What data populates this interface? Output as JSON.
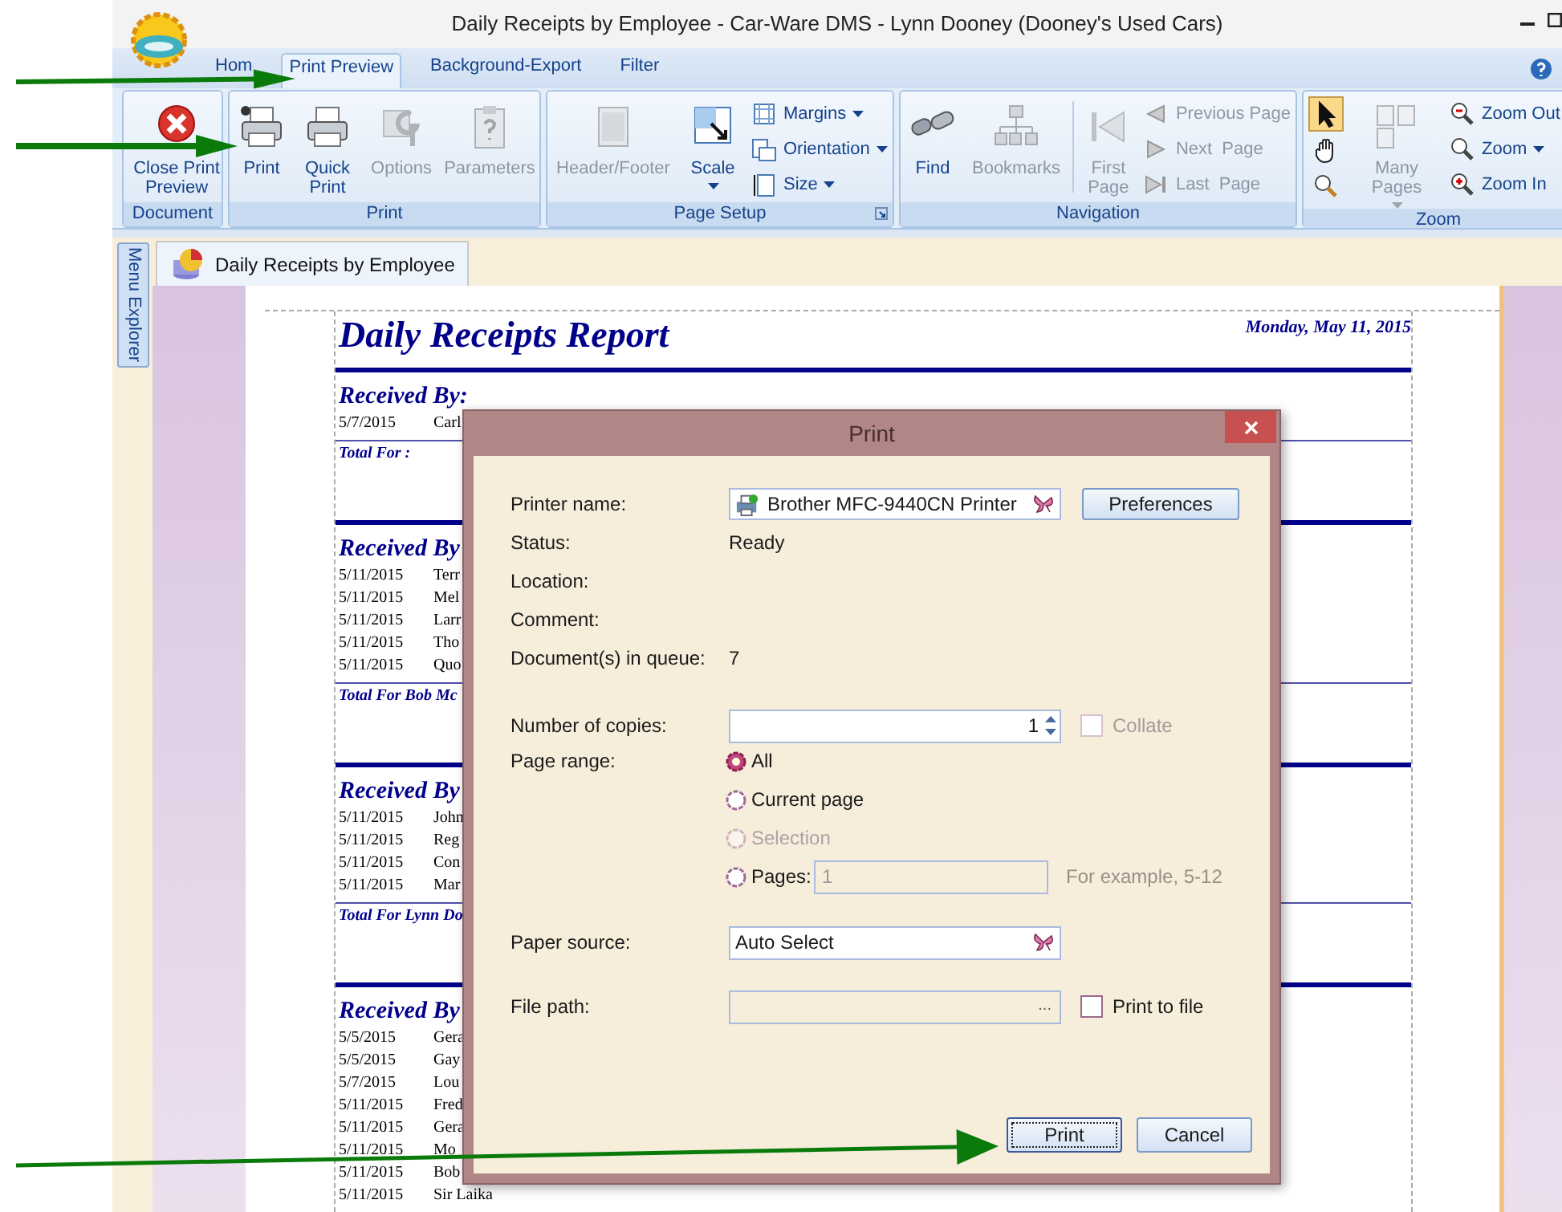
{
  "window": {
    "title": "Daily Receipts by Employee - Car-Ware DMS - Lynn Dooney (Dooney's Used Cars)"
  },
  "ribbon_tabs": [
    {
      "label": "Hom",
      "selected": false
    },
    {
      "label": "Print Preview",
      "selected": true
    },
    {
      "label": "Background-Export",
      "selected": false
    },
    {
      "label": "Filter",
      "selected": false
    }
  ],
  "ribbon_groups": [
    {
      "title": "Document",
      "launcher": false,
      "items": [
        {
          "kind": "large",
          "label": "Close Print Preview",
          "disabled": false,
          "dropdown": false
        }
      ]
    },
    {
      "title": "Print",
      "launcher": false,
      "items": [
        {
          "kind": "large",
          "label": "Print",
          "disabled": false,
          "dropdown": false
        },
        {
          "kind": "large",
          "label": "Quick Print",
          "disabled": false,
          "dropdown": false
        },
        {
          "kind": "large",
          "label": "Options",
          "disabled": true,
          "dropdown": false
        },
        {
          "kind": "large",
          "label": "Parameters",
          "disabled": true,
          "dropdown": false
        }
      ]
    },
    {
      "title": "Page Setup",
      "launcher": true,
      "items": [
        {
          "kind": "large",
          "label": "Header/Footer",
          "disabled": true,
          "dropdown": false
        },
        {
          "kind": "large",
          "label": "Scale",
          "disabled": false,
          "dropdown": true
        },
        {
          "kind": "small",
          "label": "Margins",
          "disabled": false,
          "dropdown": true
        },
        {
          "kind": "small",
          "label": "Orientation",
          "disabled": false,
          "dropdown": true
        },
        {
          "kind": "small",
          "label": "Size",
          "disabled": false,
          "dropdown": true
        }
      ]
    },
    {
      "title": "Navigation",
      "launcher": false,
      "items": [
        {
          "kind": "large",
          "label": "Find",
          "disabled": false,
          "dropdown": false
        },
        {
          "kind": "large",
          "label": "Bookmarks",
          "disabled": true,
          "dropdown": false
        },
        {
          "kind": "separator"
        },
        {
          "kind": "large",
          "label": "First Page",
          "disabled": true,
          "dropdown": false
        },
        {
          "kind": "small",
          "label": "Previous Page",
          "disabled": true,
          "dropdown": false
        },
        {
          "kind": "small",
          "label": "Next  Page",
          "disabled": true,
          "dropdown": false
        },
        {
          "kind": "small",
          "label": "Last  Page",
          "disabled": true,
          "dropdown": false
        }
      ]
    },
    {
      "title": "Zoom",
      "launcher": false,
      "items": [
        {
          "kind": "tool",
          "selected": true
        },
        {
          "kind": "tool",
          "selected": false
        },
        {
          "kind": "tool",
          "selected": false
        },
        {
          "kind": "large",
          "label": "Many Pages",
          "disabled": true,
          "dropdown": true
        },
        {
          "kind": "small",
          "label": "Zoom Out",
          "disabled": false,
          "dropdown": false
        },
        {
          "kind": "small",
          "label": "Zoom",
          "disabled": false,
          "dropdown": true
        },
        {
          "kind": "small",
          "label": "Zoom In",
          "disabled": false,
          "dropdown": false
        }
      ]
    }
  ],
  "side_tab": {
    "label": "Menu Explorer"
  },
  "document_tabs": [
    {
      "label": "Daily Receipts by Employee",
      "selected": true
    }
  ],
  "report": {
    "title": "Daily Receipts Report",
    "date": "Monday, May 11, 2015",
    "sections": [
      {
        "heading": "Received By:",
        "rows": [
          {
            "date": "5/7/2015",
            "name": "Carl"
          }
        ],
        "total": "Total For :"
      },
      {
        "heading": "Received By",
        "rows": [
          {
            "date": "5/11/2015",
            "name": "Terr"
          },
          {
            "date": "5/11/2015",
            "name": "Mel"
          },
          {
            "date": "5/11/2015",
            "name": "Larr"
          },
          {
            "date": "5/11/2015",
            "name": "Tho"
          },
          {
            "date": "5/11/2015",
            "name": "Quo"
          }
        ],
        "total": "Total For Bob Mc"
      },
      {
        "heading": "Received By",
        "rows": [
          {
            "date": "5/11/2015",
            "name": "John"
          },
          {
            "date": "5/11/2015",
            "name": "Reg"
          },
          {
            "date": "5/11/2015",
            "name": "Con"
          },
          {
            "date": "5/11/2015",
            "name": "Mar"
          }
        ],
        "total": "Total For Lynn Do"
      },
      {
        "heading": "Received By",
        "rows": [
          {
            "date": "5/5/2015",
            "name": "Gera"
          },
          {
            "date": "5/5/2015",
            "name": "Gay"
          },
          {
            "date": "5/7/2015",
            "name": "Lou"
          },
          {
            "date": "5/11/2015",
            "name": "Fred"
          },
          {
            "date": "5/11/2015",
            "name": "Gera"
          },
          {
            "date": "5/11/2015",
            "name": "Mo"
          },
          {
            "date": "5/11/2015",
            "name": "Bob"
          },
          {
            "date": "5/11/2015",
            "name": "Sir Laika"
          }
        ]
      }
    ]
  },
  "dialog": {
    "title": "Print",
    "printer": {
      "label": "Printer name:",
      "value": "Brother MFC-9440CN Printer"
    },
    "preferences_button": "Preferences",
    "info": [
      {
        "label": "Status:",
        "value": "Ready"
      },
      {
        "label": "Location:"
      },
      {
        "label": "Comment:"
      },
      {
        "label": "Document(s) in queue:",
        "value": "7"
      }
    ],
    "copies": {
      "label": "Number of copies:",
      "value": "1"
    },
    "collate": {
      "label": "Collate",
      "checked": false,
      "disabled": true
    },
    "page_range": {
      "label": "Page range:",
      "options": [
        {
          "label": "All",
          "selected": true,
          "disabled": false
        },
        {
          "label": "Current page",
          "selected": false,
          "disabled": false
        },
        {
          "label": "Selection",
          "selected": false,
          "disabled": true
        },
        {
          "label": "Pages:",
          "selected": false,
          "disabled": false
        }
      ]
    },
    "pages_field": {
      "value": "1",
      "disabled": true
    },
    "pages_hint": "For example, 5-12",
    "paper_source": {
      "label": "Paper source:",
      "value": "Auto Select"
    },
    "file_path": {
      "label": "File path:",
      "button": "..."
    },
    "print_to_file": {
      "label": "Print to file",
      "checked": false
    },
    "buttons": [
      {
        "label": "Print",
        "focused": true
      },
      {
        "label": "Cancel",
        "focused": false
      }
    ]
  }
}
